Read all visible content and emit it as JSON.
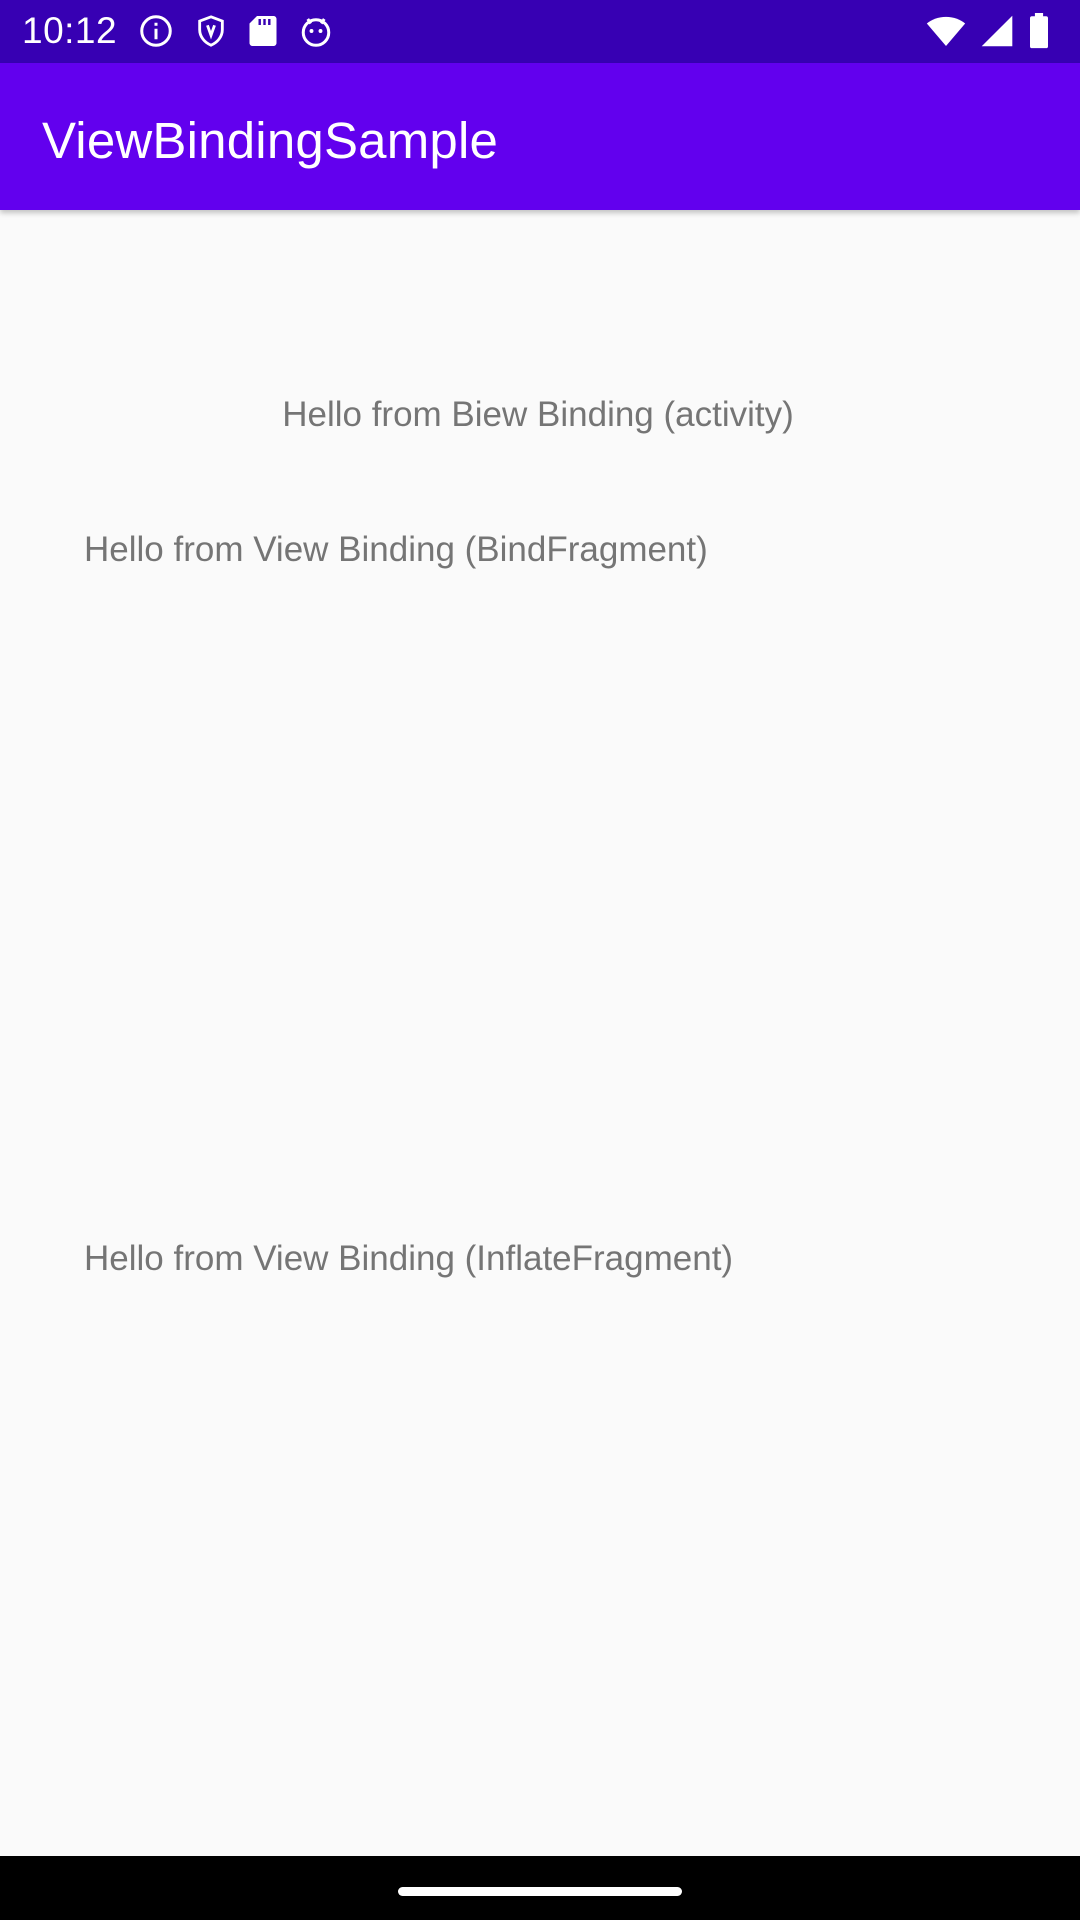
{
  "status_bar": {
    "time": "10:12",
    "left_icons": [
      "info-icon",
      "shield-icon",
      "sd-card-icon",
      "android-debug-icon"
    ],
    "right_icons": [
      "wifi-icon",
      "cellular-signal-icon",
      "battery-icon"
    ],
    "background_color": "#3700b3"
  },
  "app_bar": {
    "title": "ViewBindingSample",
    "background_color": "#6200ee"
  },
  "content": {
    "activity_text": "Hello from Biew Binding (activity)",
    "bind_fragment_text": "Hello from View Binding (BindFragment)",
    "inflate_fragment_text": "Hello from View Binding (InflateFragment)",
    "text_color": "#757575",
    "background_color": "#fafafa"
  },
  "navigation_bar": {
    "home_indicator": "home-indicator",
    "background_color": "#000000"
  }
}
